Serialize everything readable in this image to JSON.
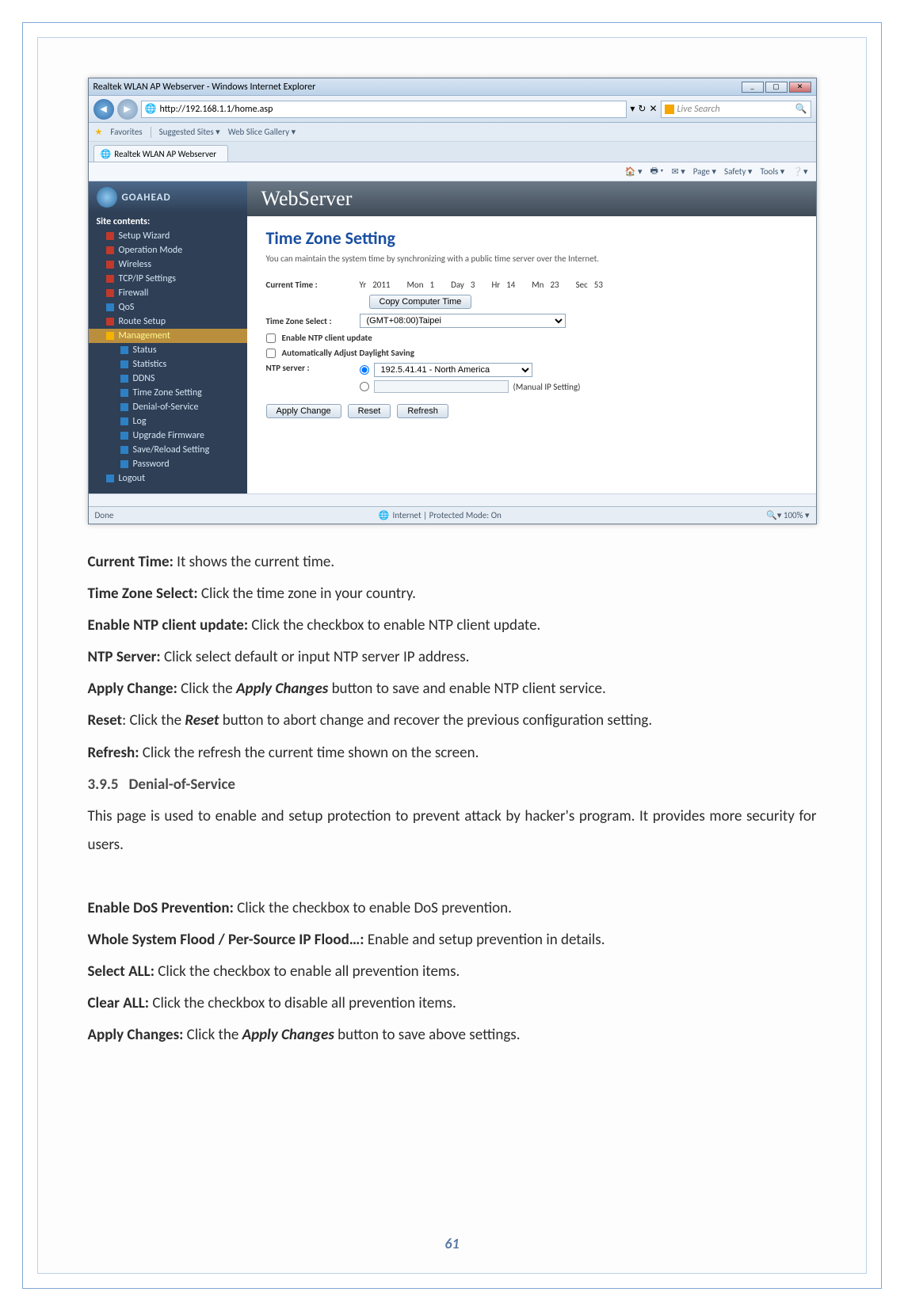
{
  "ie": {
    "window_title": "Realtek WLAN AP Webserver - Windows Internet Explorer",
    "url": "http://192.168.1.1/home.asp",
    "search_placeholder": "Live Search",
    "favorites_label": "Favorites",
    "fav_links": [
      "Suggested Sites ▾",
      "Web Slice Gallery ▾"
    ],
    "tab_label": "Realtek WLAN AP Webserver",
    "cmd": {
      "page": "Page ▾",
      "safety": "Safety ▾",
      "tools": "Tools ▾"
    },
    "status_done": "Done",
    "status_zone": "Internet | Protected Mode: On",
    "status_zoom": "100%"
  },
  "sidebar": {
    "brand": "GOAHEAD",
    "root": "Site contents:",
    "items": [
      "Setup Wizard",
      "Operation Mode",
      "Wireless",
      "TCP/IP Settings",
      "Firewall",
      "QoS",
      "Route Setup"
    ],
    "mgmt_label": "Management",
    "mgmt_items": [
      "Status",
      "Statistics",
      "DDNS",
      "Time Zone Setting",
      "Denial-of-Service",
      "Log",
      "Upgrade Firmware",
      "Save/Reload Setting",
      "Password"
    ],
    "logout": "Logout"
  },
  "webserver": {
    "banner": "WebServer",
    "title": "Time Zone Setting",
    "desc": "You can maintain the system time by synchronizing with a public time server over the Internet.",
    "current_time_label": "Current Time :",
    "yr_lbl": "Yr",
    "mon_lbl": "Mon",
    "day_lbl": "Day",
    "hr_lbl": "Hr",
    "mn_lbl": "Mn",
    "sec_lbl": "Sec",
    "yr": "2011",
    "mon": "1",
    "day": "3",
    "hr": "14",
    "mn": "23",
    "sec": "53",
    "copy_btn": "Copy Computer Time",
    "tz_label": "Time Zone Select :",
    "tz_value": "(GMT+08:00)Taipei",
    "ntp_enable": "Enable NTP client update",
    "dst": "Automatically Adjust Daylight Saving",
    "ntp_server_label": "NTP server :",
    "ntp_default": "192.5.41.41 - North America",
    "ntp_manual": "(Manual IP Setting)",
    "apply": "Apply Change",
    "reset": "Reset",
    "refresh": "Refresh"
  },
  "doc": {
    "p1_b": "Current Time:",
    "p1": " It shows the current time.",
    "p2_b": "Time Zone Select:",
    "p2": " Click the time zone in your country.",
    "p3_b": "Enable NTP client update:",
    "p3": " Click the checkbox to enable NTP client update.",
    "p4_b": "NTP Server:",
    "p4": " Click select default or input NTP server IP address.",
    "p5_b": "Apply Change:",
    "p5a": " Click the ",
    "p5_i": "Apply Changes",
    "p5b": " button to save and enable NTP client service.",
    "p6_b": "Reset",
    "p6a": ": Click the ",
    "p6_i": "Reset",
    "p6b": " button to abort change and recover the previous configuration setting.",
    "p7_b": "Refresh:",
    "p7": " Click the refresh the current time shown on the screen.",
    "sec_num": "3.9.5",
    "sec_title": "Denial-of-Service",
    "sec_p": "This page is used to enable and setup protection to prevent attack by hacker's program. It provides more security for users.",
    "d1_b": "Enable DoS Prevention:",
    "d1": " Click the checkbox to enable DoS prevention.",
    "d2_b": "Whole System Flood / Per-Source IP Flood…:",
    "d2": " Enable and setup prevention in details.",
    "d3_b": "Select ALL:",
    "d3": " Click the checkbox to enable all prevention items.",
    "d4_b": "Clear ALL:",
    "d4": " Click the checkbox to disable all prevention items.",
    "d5_b": "Apply Changes:",
    "d5a": " Click the ",
    "d5_i": "Apply Changes",
    "d5b": " button to save above settings."
  },
  "page_number": "61"
}
